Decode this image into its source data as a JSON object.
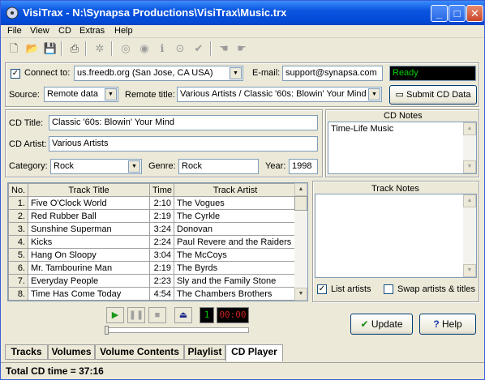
{
  "window": {
    "title": "VisiTrax - N:\\Synapsa Productions\\VisiTrax\\Music.trx"
  },
  "menu": [
    "File",
    "View",
    "CD",
    "Extras",
    "Help"
  ],
  "connect": {
    "label": "Connect to:",
    "checked": true,
    "server": "us.freedb.org (San Jose, CA USA)"
  },
  "email": {
    "label": "E-mail:",
    "value": "support@synapsa.com"
  },
  "status": "Ready",
  "source": {
    "label": "Source:",
    "value": "Remote data"
  },
  "remote_title": {
    "label": "Remote title:",
    "value": "Various Artists / Classic '60s: Blowin' Your Mind"
  },
  "submit_label": "Submit CD Data",
  "cd_title": {
    "label": "CD Title:",
    "value": "Classic '60s: Blowin' Your Mind"
  },
  "cd_artist": {
    "label": "CD Artist:",
    "value": "Various Artists"
  },
  "category": {
    "label": "Category:",
    "value": "Rock"
  },
  "genre": {
    "label": "Genre:",
    "value": "Rock"
  },
  "year": {
    "label": "Year:",
    "value": "1998"
  },
  "cd_notes": {
    "label": "CD Notes",
    "value": "Time-Life Music"
  },
  "tracks": {
    "headers": [
      "No.",
      "Track Title",
      "Time",
      "Track Artist"
    ],
    "rows": [
      {
        "no": "1.",
        "title": "Five O'Clock World",
        "time": "2:10",
        "artist": "The Vogues"
      },
      {
        "no": "2.",
        "title": "Red Rubber Ball",
        "time": "2:19",
        "artist": "The Cyrkle"
      },
      {
        "no": "3.",
        "title": "Sunshine Superman",
        "time": "3:24",
        "artist": "Donovan"
      },
      {
        "no": "4.",
        "title": "Kicks",
        "time": "2:24",
        "artist": "Paul Revere and the Raiders"
      },
      {
        "no": "5.",
        "title": "Hang On Sloopy",
        "time": "3:04",
        "artist": "The McCoys"
      },
      {
        "no": "6.",
        "title": "Mr. Tambourine Man",
        "time": "2:19",
        "artist": "The Byrds"
      },
      {
        "no": "7.",
        "title": "Everyday People",
        "time": "2:23",
        "artist": "Sly and the Family Stone"
      },
      {
        "no": "8.",
        "title": "Time Has Come Today",
        "time": "4:54",
        "artist": "The Chambers Brothers"
      }
    ]
  },
  "track_notes": {
    "label": "Track Notes",
    "value": ""
  },
  "options": {
    "list_artists": {
      "label": "List artists",
      "checked": true
    },
    "swap": {
      "label": "Swap artists & titles",
      "checked": false
    }
  },
  "player": {
    "track": "1",
    "time": "00:00"
  },
  "buttons": {
    "update": "Update",
    "help": "Help"
  },
  "tabs": [
    "Tracks",
    "Volumes",
    "Volume Contents",
    "Playlist",
    "CD Player"
  ],
  "active_tab": "CD Player",
  "statusbar": "Total CD time = 37:16"
}
